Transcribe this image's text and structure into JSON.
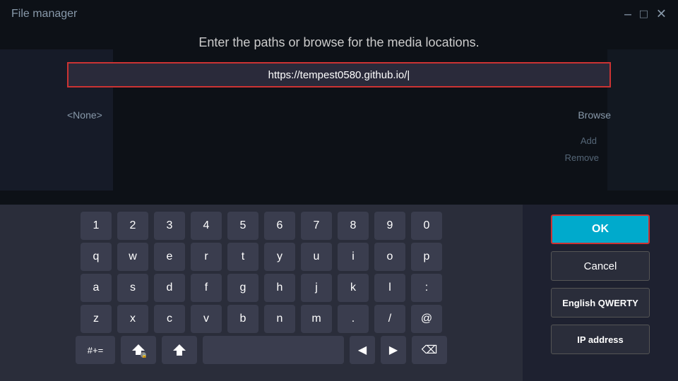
{
  "title": "File manager",
  "title_icons": [
    "–",
    "□",
    "✕"
  ],
  "subtitle": "Enter the paths or browse for the media locations.",
  "url_input": {
    "value": "https://tempest0580.github.io/|",
    "placeholder": "https://tempest0580.github.io/|"
  },
  "none_label": "<None>",
  "browse_label": "Browse",
  "add_label": "Add",
  "remove_label": "Remove",
  "keyboard": {
    "row1": [
      "1",
      "2",
      "3",
      "4",
      "5",
      "6",
      "7",
      "8",
      "9",
      "0"
    ],
    "row2": [
      "q",
      "w",
      "e",
      "r",
      "t",
      "y",
      "u",
      "i",
      "o",
      "p"
    ],
    "row3": [
      "a",
      "s",
      "d",
      "f",
      "g",
      "h",
      "j",
      "k",
      "l",
      ":"
    ],
    "row4": [
      "z",
      "x",
      "c",
      "v",
      "b",
      "n",
      "m",
      ".",
      "/",
      "@"
    ]
  },
  "buttons": {
    "ok": "OK",
    "cancel": "Cancel",
    "language": "English QWERTY",
    "ip_address": "IP address"
  }
}
